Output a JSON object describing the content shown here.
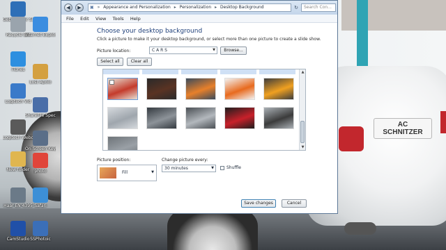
{
  "desktop": {
    "icons": [
      {
        "label": "Gebrouwser Shelves",
        "color": "#2e6fb7"
      },
      {
        "label": "Recycle Bin",
        "color": "#9aa4ad"
      },
      {
        "label": "iTunes",
        "color": "#2d8fe0"
      },
      {
        "label": "Logitech Vid",
        "color": "#3a7ac9"
      },
      {
        "label": "Logitech Webca",
        "color": "#5a5a5a"
      },
      {
        "label": "New folder",
        "color": "#e0b650"
      },
      {
        "label": "Haar EN 4395",
        "color": "#6b7a88"
      },
      {
        "label": "CamStudio",
        "color": "#2050a8"
      },
      {
        "label": "Internet Explorer",
        "color": "#3b8de0"
      },
      {
        "label": "Lost Apolo",
        "color": "#d4a040"
      },
      {
        "label": "ShareFile Special",
        "color": "#4a6ea8"
      },
      {
        "label": "On-Screen Keyboard",
        "color": "#5a6e88"
      },
      {
        "label": "photo",
        "color": "#e0453a"
      },
      {
        "label": "Safari",
        "color": "#3d8fd6"
      },
      {
        "label": "SSPhotoic",
        "color": "#3b6fb8"
      }
    ],
    "wallpaper_plate": "AC\nSCHNITZER"
  },
  "window": {
    "address": {
      "crumbs": [
        "Appearance and Personalization",
        "Personalization",
        "Desktop Background"
      ]
    },
    "search_placeholder": "Search Con...",
    "menu": [
      "File",
      "Edit",
      "View",
      "Tools",
      "Help"
    ],
    "title": "Choose your desktop background",
    "description": "Click a picture to make it your desktop background, or select more than one picture to create a slide show.",
    "picture_location_label": "Picture location:",
    "picture_location_value": "C A R S",
    "browse_label": "Browse...",
    "select_all_label": "Select all",
    "clear_all_label": "Clear all",
    "thumbnails": [
      {
        "colors": [
          "#c43b2c",
          "#e6e1d5"
        ],
        "selected": true
      },
      {
        "colors": [
          "#5a3323",
          "#2a2a2a"
        ],
        "selected": false
      },
      {
        "colors": [
          "#e8802a",
          "#3a4b5c"
        ],
        "selected": false
      },
      {
        "colors": [
          "#e86a1e",
          "#f2f2f2"
        ],
        "selected": false
      },
      {
        "colors": [
          "#f0a020",
          "#3c3c3c"
        ],
        "selected": false
      },
      {
        "colors": [
          "#9fa6ad",
          "#d5d9dd"
        ],
        "selected": false
      },
      {
        "colors": [
          "#8d9399",
          "#343a40"
        ],
        "selected": false
      },
      {
        "colors": [
          "#b3b8bd",
          "#4a4f54"
        ],
        "selected": false
      },
      {
        "colors": [
          "#c8202a",
          "#1e1e1e"
        ],
        "selected": false
      },
      {
        "colors": [
          "#3b3b3b",
          "#aab0b5"
        ],
        "selected": false
      },
      {
        "colors": [
          "#9aa0a6",
          "#6e7479"
        ],
        "selected": false
      }
    ],
    "picture_position_label": "Picture position:",
    "picture_position_value": "Fill",
    "change_every_label": "Change picture every:",
    "change_every_value": "30 minutes",
    "shuffle_label": "Shuffle",
    "save_label": "Save changes",
    "cancel_label": "Cancel"
  }
}
